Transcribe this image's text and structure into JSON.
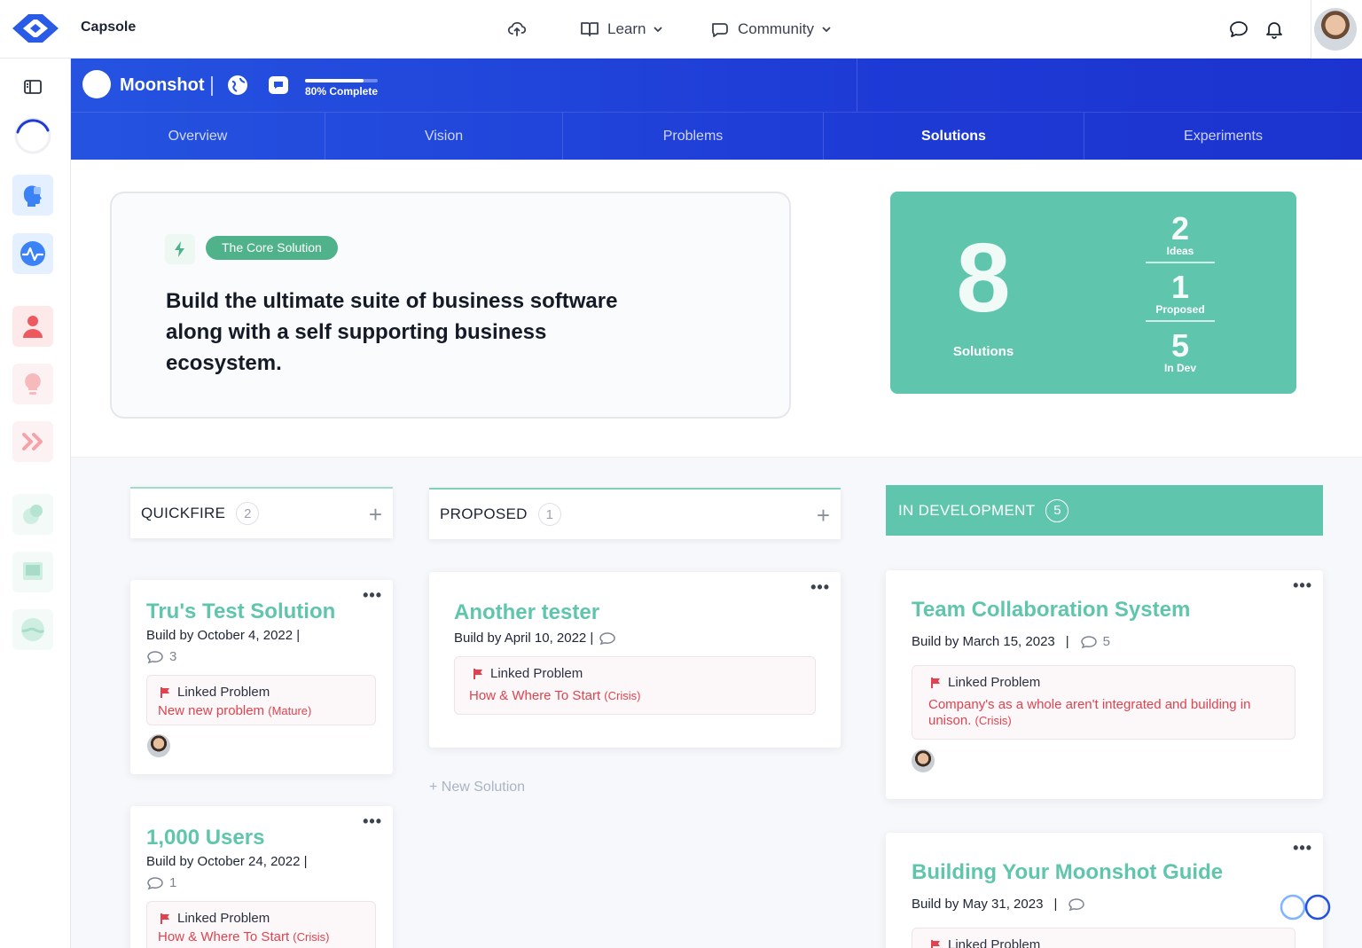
{
  "topbar": {
    "brand": "Capsole",
    "nav": [
      {
        "label": "Learn"
      },
      {
        "label": "Community"
      }
    ]
  },
  "project": {
    "name": "Moonshot",
    "progress_label": "80% Complete",
    "progress_fraction": 0.8
  },
  "tabs": [
    {
      "label": "Overview"
    },
    {
      "label": "Vision"
    },
    {
      "label": "Problems"
    },
    {
      "label": "Solutions"
    },
    {
      "label": "Experiments"
    }
  ],
  "core": {
    "badge": "The Core Solution",
    "text": "Build the ultimate suite of business software along with a self supporting business ecosystem."
  },
  "stats": {
    "total": "8",
    "total_label": "Solutions",
    "rows": [
      {
        "num": "2",
        "label": "Ideas"
      },
      {
        "num": "1",
        "label": "Proposed"
      },
      {
        "num": "5",
        "label": "In Dev"
      }
    ]
  },
  "columns": {
    "quickfire": {
      "title": "QUICKFIRE",
      "count": "2"
    },
    "proposed": {
      "title": "PROPOSED",
      "count": "1"
    },
    "dev": {
      "title": "IN DEVELOPMENT",
      "count": "5"
    }
  },
  "new_solution": "+ New Solution",
  "linked_label": "Linked Problem",
  "cards": {
    "c1": {
      "title": "Tru's Test Solution",
      "meta": "Build by October 4, 2022 |",
      "comments": "3",
      "problem": "New new problem",
      "state": "(Mature)"
    },
    "c2": {
      "title": "1,000 Users",
      "meta": "Build by October 24, 2022 |",
      "comments": "1",
      "problem": "How & Where To Start",
      "state": "(Crisis)"
    },
    "c3": {
      "title": "Another tester",
      "meta": "Build by April 10, 2022 |",
      "problem": "How & Where To Start",
      "state": "(Crisis)"
    },
    "c4": {
      "title": "Team Collaboration System",
      "meta": "Build by March 15, 2023",
      "comments": "5",
      "problem": "Company's as a whole aren't integrated and building in unison.",
      "state": "(Crisis)"
    },
    "c5": {
      "title": "Building Your Moonshot Guide",
      "meta": "Build by May 31, 2023",
      "problem": "Linked Problem"
    }
  },
  "icons": {
    "topbar": [
      "upload-cloud-icon",
      "book-icon",
      "chat-icon",
      "message-icon",
      "bell-icon"
    ],
    "sidebar": [
      "panel-toggle-icon",
      "spinner-icon",
      "brain-icon",
      "pulse-icon",
      "person-icon",
      "bulb-icon",
      "chevrons-icon",
      "blob-icon",
      "screen-icon",
      "globe-icon"
    ]
  },
  "colors": {
    "primary": "#1e3bd6",
    "accent": "#5fc5ad",
    "badge": "#4fb28b",
    "danger": "#e0434f"
  }
}
